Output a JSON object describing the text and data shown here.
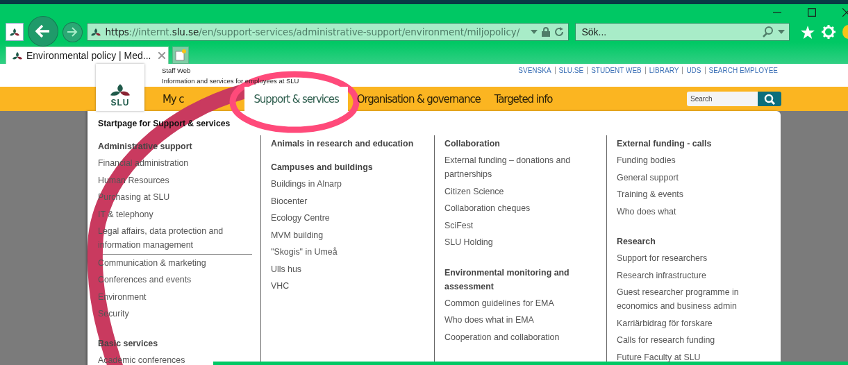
{
  "browser": {
    "url": {
      "parts": [
        {
          "text": "https",
          "emphasis": true
        },
        {
          "text": "://internt.",
          "emphasis": false
        },
        {
          "text": "slu.se",
          "emphasis": true
        },
        {
          "text": "/en/support-services/administrative-support/environment/miljopolicy/",
          "emphasis": false
        }
      ]
    },
    "search": {
      "placeholder": "Sök..."
    },
    "tabs": [
      {
        "label": "Environmental policy | Med...",
        "selected": true
      }
    ]
  },
  "site": {
    "header": {
      "title": "Staff Web",
      "subtitle": "Information and services for employees at SLU",
      "logo_text": "SLU",
      "top_links": [
        "SVENSKA",
        "SLU.SE",
        "STUDENT WEB",
        "LIBRARY",
        "UDS",
        "SEARCH EMPLOYEE"
      ],
      "nav": [
        {
          "label": "My c",
          "selected": false
        },
        {
          "label": "Support & services",
          "selected": true
        },
        {
          "label": "Organisation & governance",
          "selected": false
        },
        {
          "label": "Targeted info",
          "selected": false
        }
      ],
      "search": {
        "placeholder": "Search"
      }
    },
    "menu": {
      "start_link": "Startpage for Support & services",
      "columns": [
        {
          "groups": [
            {
              "heading": "Administrative support",
              "items": [
                {
                  "label": "Financial administration"
                },
                {
                  "label": "Human Resources"
                },
                {
                  "label": "Purchasing at SLU"
                },
                {
                  "label": "IT & telephony"
                },
                {
                  "label": "Legal affairs, data protection and information management",
                  "divider_after": true
                },
                {
                  "label": "Communication & marketing"
                },
                {
                  "label": "Conferences and events"
                },
                {
                  "label": "Environment"
                },
                {
                  "label": "Security"
                }
              ]
            },
            {
              "heading": "Basic services",
              "items": [
                {
                  "label": "Academic conferences"
                }
              ]
            }
          ]
        },
        {
          "groups": [
            {
              "heading": "Animals in research and education"
            },
            {
              "heading": "Campuses and buildings",
              "items": [
                {
                  "label": "Buildings in Alnarp"
                },
                {
                  "label": "Biocenter"
                },
                {
                  "label": "Ecology Centre"
                },
                {
                  "label": "MVM building"
                },
                {
                  "label": "\"Skogis\" in Umeå"
                },
                {
                  "label": "Ulls hus"
                },
                {
                  "label": "VHC"
                }
              ]
            }
          ]
        },
        {
          "groups": [
            {
              "heading": "Collaboration",
              "items": [
                {
                  "label": "External funding – donations and partnerships"
                },
                {
                  "label": "Citizen Science"
                },
                {
                  "label": "Collaboration cheques"
                },
                {
                  "label": "SciFest"
                },
                {
                  "label": "SLU Holding"
                }
              ]
            },
            {
              "heading": "Environmental monitoring and assessment",
              "items": [
                {
                  "label": "Common guidelines for EMA"
                },
                {
                  "label": "Who does what in EMA"
                },
                {
                  "label": "Cooperation and collaboration"
                }
              ]
            }
          ]
        },
        {
          "groups": [
            {
              "heading": "External funding - calls",
              "items": [
                {
                  "label": "Funding bodies"
                },
                {
                  "label": "General support"
                },
                {
                  "label": "Training & events"
                },
                {
                  "label": "Who does what"
                }
              ]
            },
            {
              "heading": "Research",
              "items": [
                {
                  "label": "Support for researchers"
                },
                {
                  "label": "Research infrastructure"
                },
                {
                  "label": "Guest researcher programme in economics and business admin"
                },
                {
                  "label": "Karriärbidrag för forskare"
                },
                {
                  "label": "Calls for research funding"
                },
                {
                  "label": "Future Faculty at SLU"
                }
              ]
            }
          ]
        }
      ]
    }
  }
}
